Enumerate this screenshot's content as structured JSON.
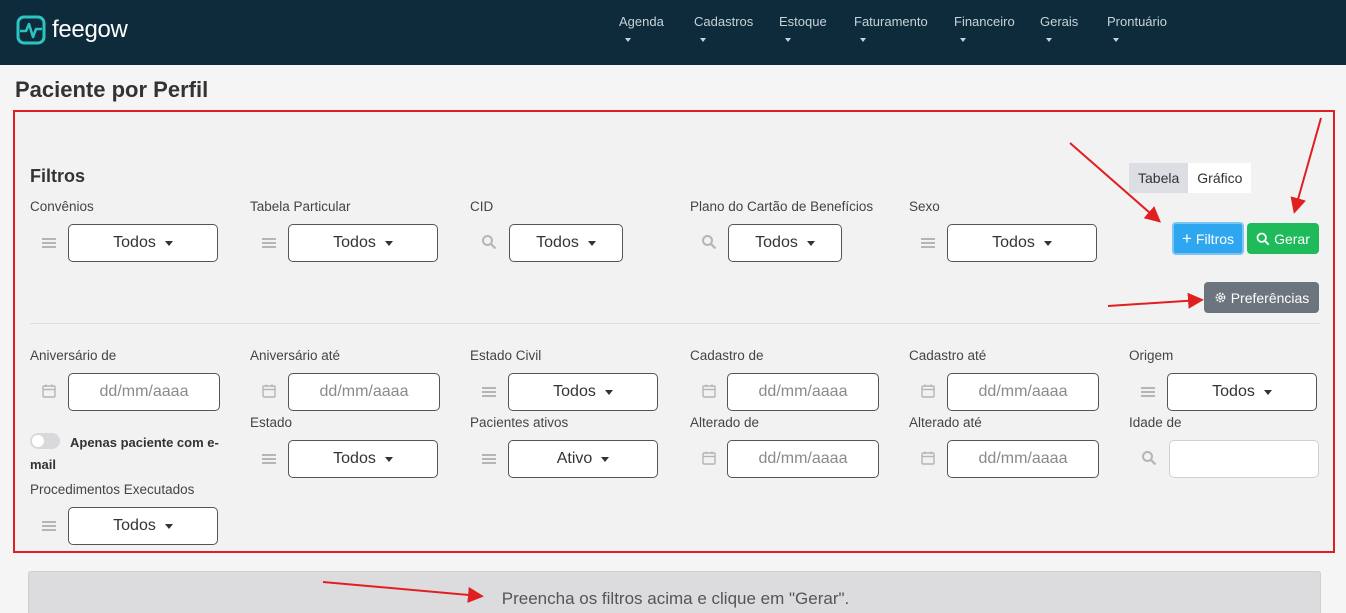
{
  "app": {
    "logo_text": "feegow"
  },
  "nav": {
    "items": [
      {
        "label": "Agenda"
      },
      {
        "label": "Cadastros"
      },
      {
        "label": "Estoque"
      },
      {
        "label": "Faturamento"
      },
      {
        "label": "Financeiro"
      },
      {
        "label": "Gerais"
      },
      {
        "label": "Prontuário"
      }
    ]
  },
  "page": {
    "title": "Paciente por Perfil"
  },
  "filters": {
    "title": "Filtros",
    "view_toggle": {
      "tabela": "Tabela",
      "grafico": "Gráfico",
      "selected": "Tabela"
    },
    "buttons": {
      "filtros": "Filtros",
      "gerar": "Gerar",
      "preferencias": "Preferências"
    },
    "row1": {
      "convenios": {
        "label": "Convênios",
        "value": "Todos",
        "icon": "list-icon"
      },
      "tabela_particular": {
        "label": "Tabela Particular",
        "value": "Todos",
        "icon": "list-icon"
      },
      "cid": {
        "label": "CID",
        "value": "Todos",
        "icon": "search-icon"
      },
      "plano_cartao": {
        "label": "Plano do Cartão de Benefícios",
        "value": "Todos",
        "icon": "search-icon"
      },
      "sexo": {
        "label": "Sexo",
        "value": "Todos",
        "icon": "list-icon"
      }
    },
    "advanced": {
      "aniversario_de": {
        "label": "Aniversário de",
        "placeholder": "dd/mm/aaaa"
      },
      "aniversario_ate": {
        "label": "Aniversário até",
        "placeholder": "dd/mm/aaaa"
      },
      "estado_civil": {
        "label": "Estado Civil",
        "value": "Todos"
      },
      "cadastro_de": {
        "label": "Cadastro de",
        "placeholder": "dd/mm/aaaa"
      },
      "cadastro_ate": {
        "label": "Cadastro até",
        "placeholder": "dd/mm/aaaa"
      },
      "origem": {
        "label": "Origem",
        "value": "Todos"
      },
      "apenas_email": {
        "label_line1": "Apenas paciente com e-",
        "label_line2": "mail",
        "checked": false
      },
      "estado": {
        "label": "Estado",
        "value": "Todos"
      },
      "pacientes_ativos": {
        "label": "Pacientes ativos",
        "value": "Ativo"
      },
      "alterado_de": {
        "label": "Alterado de",
        "placeholder": "dd/mm/aaaa"
      },
      "alterado_ate": {
        "label": "Alterado até",
        "placeholder": "dd/mm/aaaa"
      },
      "idade_de": {
        "label": "Idade de",
        "value": ""
      },
      "procedimentos": {
        "label": "Procedimentos Executados",
        "value": "Todos"
      }
    }
  },
  "notice": {
    "text": "Preencha os filtros acima e clique em \"Gerar\"."
  },
  "colors": {
    "navbar": "#0d2b3a",
    "filtros_button": "#2ea7f0",
    "gerar_button": "#1fbb5b",
    "preferencias_button": "#6c757d",
    "highlight": "#e02020"
  }
}
